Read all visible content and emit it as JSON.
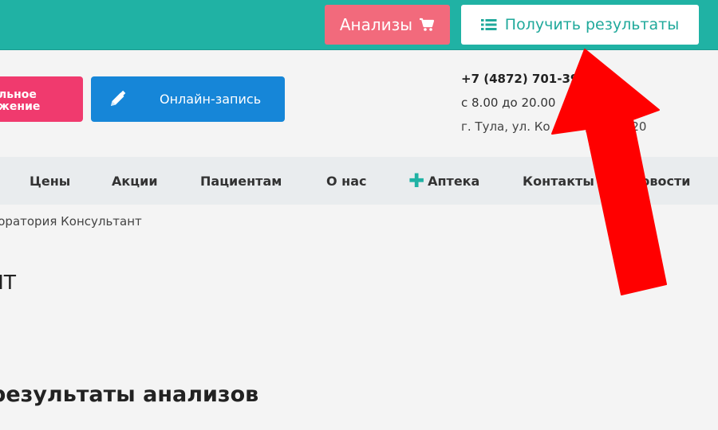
{
  "topbar": {
    "analyses_label": "Анализы",
    "analyses_icon": "cart-icon",
    "results_label": "Получить результаты",
    "results_icon": "list-icon"
  },
  "header": {
    "pink_button_lines": [
      "льное",
      "жение"
    ],
    "online_button_label": "Онлайн-запись",
    "online_button_icon": "pencil-icon",
    "phone": "+7 (4872) 701-39",
    "hours": "с 8.00 до 20.00",
    "address_part1": "г. Тула, ул. Ко",
    "address_part2": "д. 18а, 20"
  },
  "nav": {
    "items": [
      "Цены",
      "Акции",
      "Пациентам",
      "О нас",
      "Аптека",
      "Контакты",
      "Новости"
    ]
  },
  "breadcrumb": "боратория Консультант",
  "page_title": "НТ",
  "section_title": "результаты анализов",
  "annotation": {
    "arrow_color": "#ff0000",
    "arrow_icon": "red-arrow-icon"
  },
  "colors": {
    "teal": "#20b2a4",
    "pink": "#f03a6e",
    "coral": "#f26a7c",
    "blue": "#1686d8"
  }
}
